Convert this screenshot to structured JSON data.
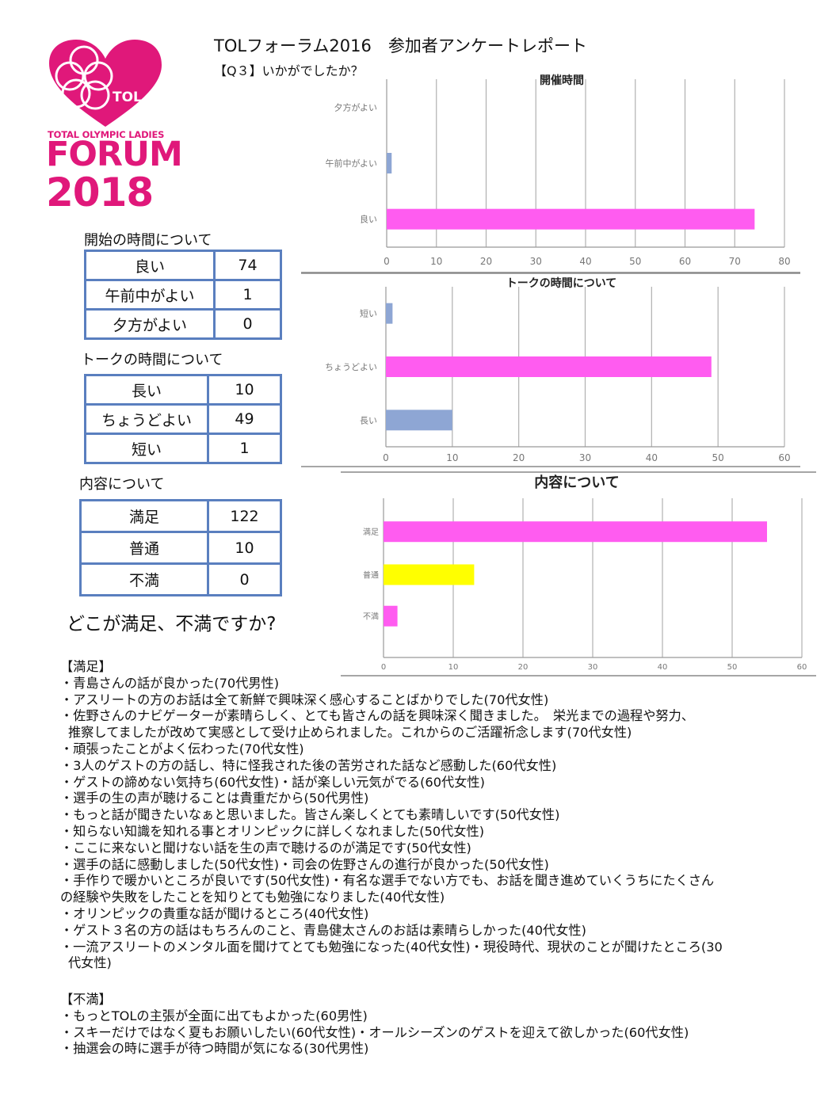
{
  "logo": {
    "mark_text": "TOL",
    "line1": "TOTAL OLYMPIC LADIES",
    "line2": "FORUM",
    "line3": "2018",
    "color": "#e0187a"
  },
  "header": {
    "title": "TOLフォーラム2016　参加者アンケートレポート",
    "subtitle": "【Q３】いかがでしたか？"
  },
  "tables": [
    {
      "caption": "開始の時間について",
      "rows": [
        {
          "label": "良い",
          "value": "74"
        },
        {
          "label": "午前中がよい",
          "value": "1"
        },
        {
          "label": "夕方がよい",
          "value": "0"
        }
      ]
    },
    {
      "caption": "トークの時間について",
      "rows": [
        {
          "label": "長い",
          "value": "10"
        },
        {
          "label": "ちょうどよい",
          "value": "49"
        },
        {
          "label": "短い",
          "value": "1"
        }
      ]
    },
    {
      "caption": "内容について",
      "rows": [
        {
          "label": "満足",
          "value": "122"
        },
        {
          "label": "普通",
          "value": "10"
        },
        {
          "label": "不満",
          "value": "0"
        }
      ]
    }
  ],
  "chart_data": [
    {
      "type": "bar",
      "orientation": "horizontal",
      "title": "開催時間",
      "categories": [
        "良い",
        "午前中がよい",
        "夕方がよい"
      ],
      "values": [
        74,
        1,
        0
      ],
      "colors": [
        "#ff5cf0",
        "#8ea6d4",
        "#8ea6d4"
      ],
      "xlim": [
        0,
        80
      ],
      "ticks": [
        "0",
        "10",
        "20",
        "30",
        "40",
        "50",
        "60",
        "70",
        "80"
      ],
      "grid": true,
      "xlabel": "",
      "ylabel": ""
    },
    {
      "type": "bar",
      "orientation": "horizontal",
      "title": "トークの時間について",
      "categories": [
        "長い",
        "ちょうどよい",
        "短い"
      ],
      "values": [
        10,
        49,
        1
      ],
      "colors": [
        "#8ea6d4",
        "#ff5cf0",
        "#8ea6d4"
      ],
      "xlim": [
        0,
        60
      ],
      "ticks": [
        "0",
        "10",
        "20",
        "30",
        "40",
        "50",
        "60"
      ],
      "grid": true,
      "xlabel": "",
      "ylabel": ""
    },
    {
      "type": "bar",
      "orientation": "horizontal",
      "title": "内容について",
      "categories": [
        "満足",
        "普通",
        "不満"
      ],
      "values": [
        55,
        13,
        2
      ],
      "colors": [
        "#ff5cf0",
        "#ffff00",
        "#ff5cf0"
      ],
      "xlim": [
        0,
        60
      ],
      "ticks": [
        "0",
        "10",
        "20",
        "30",
        "40",
        "50",
        "60"
      ],
      "grid": true,
      "xlabel": "",
      "ylabel": ""
    }
  ],
  "question": "どこが満足、不満ですか?",
  "satisfied": {
    "heading": "【満足】",
    "lines": [
      "・青島さんの話が良かった(70代男性)",
      "・アスリートの方のお話は全て新鮮で興味深く感心することばかりでした(70代女性)",
      "・佐野さんのナビゲーターが素晴らしく、とても皆さんの話を興味深く聞きました。　栄光までの過程や努力、",
      "推察してましたが改めて実感として受け止められました。これからのご活躍祈念します(70代女性)",
      "・頑張ったことがよく伝わった(70代女性)",
      "・3人のゲストの方の話し、特に怪我された後の苦労された話など感動した(60代女性)",
      "・ゲストの諦めない気持ち(60代女性)・話が楽しい元気がでる(60代女性)",
      "・選手の生の声が聴けることは貴重だから(50代男性)",
      "・もっと話が聞きたいなぁと思いました。皆さん楽しくとても素晴しいです(50代女性)",
      "・知らない知識を知れる事とオリンピックに詳しくなれました(50代女性)",
      "・ここに来ないと聞けない話を生の声で聴けるのが満足です(50代女性)",
      "・選手の話に感動しました(50代女性)・司会の佐野さんの進行が良かった(50代女性)",
      "・手作りで暖かいところが良いです(50代女性)・有名な選手でない方でも、お話を聞き進めていくうちにたくさん",
      "の経験や失敗をしたことを知りとても勉強になりました(40代女性)",
      "・オリンピックの貴重な話が聞けるところ(40代女性)",
      "・ゲスト３名の方の話はもちろんのこと、青島健太さんのお話は素晴らしかった(40代女性)",
      "・一流アスリートのメンタル面を聞けてとても勉強になった(40代女性)・現役時代、現状のことが聞けたところ(30",
      "代女性)"
    ]
  },
  "dissatisfied": {
    "heading": "【不満】",
    "lines": [
      "・もっとTOLの主張が全面に出てもよかった(60男性)",
      "・スキーだけではなく夏もお願いしたい(60代女性)・オールシーズンのゲストを迎えて欲しかった(60代女性)",
      "・抽選会の時に選手が待つ時間が気になる(30代男性)"
    ]
  }
}
